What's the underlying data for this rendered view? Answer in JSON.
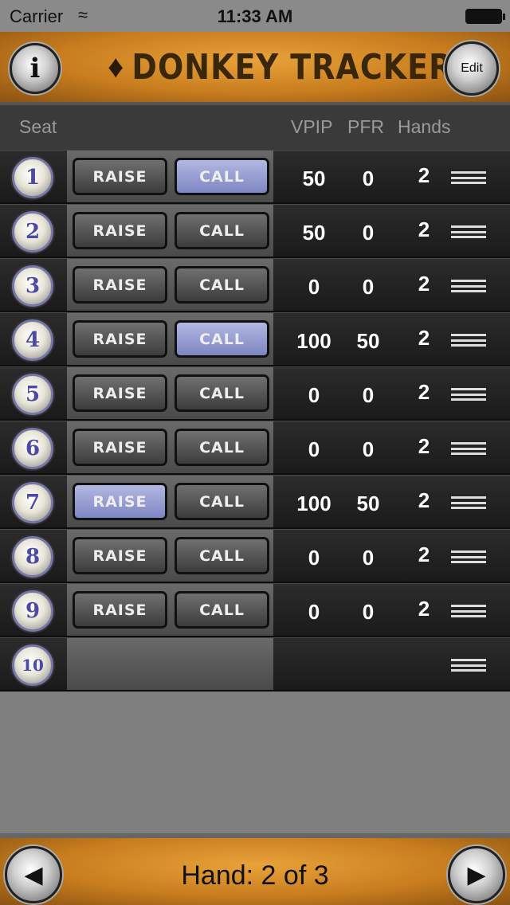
{
  "status": {
    "carrier": "Carrier",
    "time": "11:33 AM"
  },
  "header": {
    "title": "DONKEY TRACKER",
    "info_label": "i",
    "edit_label": "Edit"
  },
  "columns": {
    "seat": "Seat",
    "vpip": "VPIP",
    "pfr": "PFR",
    "hands": "Hands"
  },
  "labels": {
    "raise": "RAISE",
    "call": "CALL"
  },
  "rows": [
    {
      "seat": "1",
      "raise": false,
      "call": true,
      "vpip": "50",
      "pfr": "0",
      "hands": "2"
    },
    {
      "seat": "2",
      "raise": false,
      "call": false,
      "vpip": "50",
      "pfr": "0",
      "hands": "2"
    },
    {
      "seat": "3",
      "raise": false,
      "call": false,
      "vpip": "0",
      "pfr": "0",
      "hands": "2"
    },
    {
      "seat": "4",
      "raise": false,
      "call": true,
      "vpip": "100",
      "pfr": "50",
      "hands": "2"
    },
    {
      "seat": "5",
      "raise": false,
      "call": false,
      "vpip": "0",
      "pfr": "0",
      "hands": "2"
    },
    {
      "seat": "6",
      "raise": false,
      "call": false,
      "vpip": "0",
      "pfr": "0",
      "hands": "2"
    },
    {
      "seat": "7",
      "raise": true,
      "call": false,
      "vpip": "100",
      "pfr": "50",
      "hands": "2"
    },
    {
      "seat": "8",
      "raise": false,
      "call": false,
      "vpip": "0",
      "pfr": "0",
      "hands": "2"
    },
    {
      "seat": "9",
      "raise": false,
      "call": false,
      "vpip": "0",
      "pfr": "0",
      "hands": "2"
    },
    {
      "seat": "10",
      "empty": true
    }
  ],
  "footer": {
    "hand_label": "Hand: 2 of 3"
  },
  "colors": {
    "active_button": "#9aa0d4",
    "rust": "#c87d1e"
  },
  "icons": {
    "wifi": "wifi-icon",
    "battery": "battery-icon",
    "donkey": "donkey-logo-icon",
    "reorder": "reorder-grip-icon",
    "prev": "triangle-left-icon",
    "next": "triangle-right-icon"
  }
}
